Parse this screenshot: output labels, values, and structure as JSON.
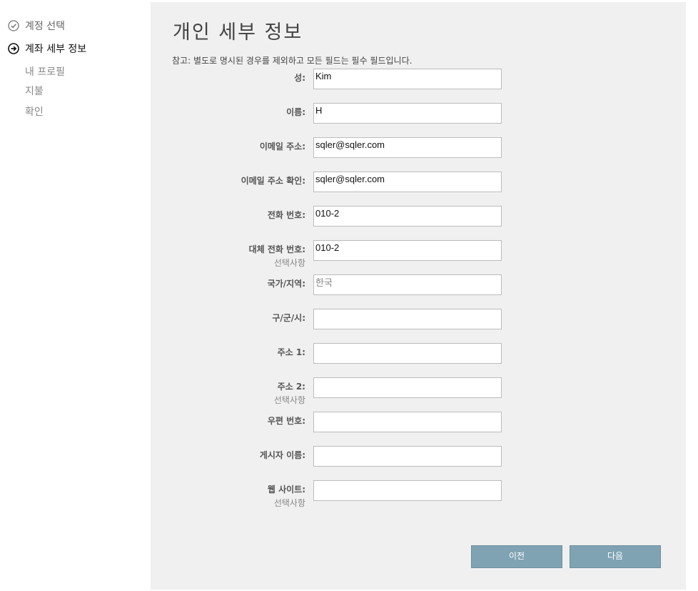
{
  "sidebar": {
    "steps": [
      {
        "label": "계정 선택",
        "icon": "check-circle-icon",
        "status": "done"
      },
      {
        "label": "계좌 세부 정보",
        "icon": "arrow-circle-icon",
        "status": "current"
      }
    ],
    "substeps": [
      "내 프로필",
      "지불",
      "확인"
    ]
  },
  "main": {
    "title": "개인 세부 정보",
    "note": "참고: 별도로 명시된 경우를 제외하고 모든 필드는 필수 필드입니다.",
    "optional_label": "선택사항",
    "fields": [
      {
        "label": "성:",
        "value": "Kim"
      },
      {
        "label": "이름:",
        "value": "H"
      },
      {
        "label": "이메일 주소:",
        "value": "sqler@sqler.com"
      },
      {
        "label": "이메일 주소 확인:",
        "value": "sqler@sqler.com"
      },
      {
        "label": "전화 번호:",
        "value": "010-2"
      },
      {
        "label": "대체 전화 번호:",
        "value": "010-2",
        "optional": true
      },
      {
        "label": "국가/지역:",
        "value": "한국",
        "readonly": true
      },
      {
        "label": "구/군/시:",
        "value": ""
      },
      {
        "label": "주소 1:",
        "value": ""
      },
      {
        "label": "주소 2:",
        "value": "",
        "optional": true
      },
      {
        "label": "우편 번호:",
        "value": ""
      },
      {
        "label": "게시자 이름:",
        "value": ""
      },
      {
        "label": "웹 사이트:",
        "value": "",
        "optional": true
      }
    ],
    "buttons": {
      "prev": "이전",
      "next": "다음"
    }
  },
  "colors": {
    "panel_bg": "#f0f0f0",
    "button_bg": "#7fa3b3"
  }
}
